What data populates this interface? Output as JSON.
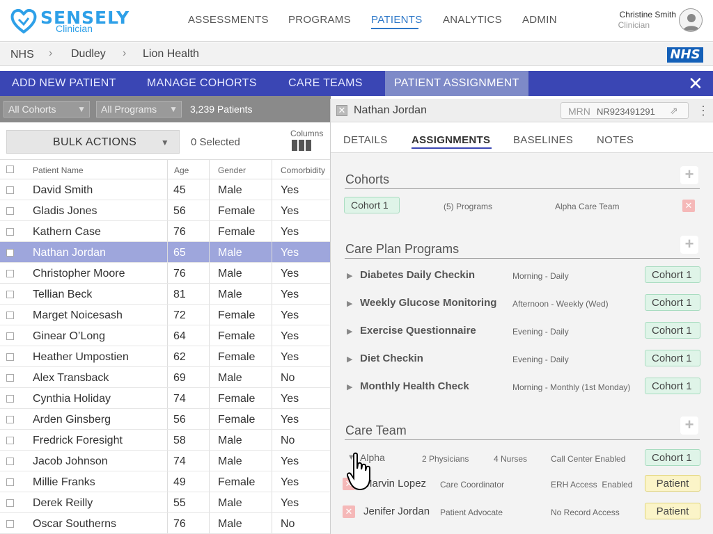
{
  "app": {
    "brand": "SENSELY",
    "subbrand": "Clinician",
    "nav": [
      "ASSESSMENTS",
      "PROGRAMS",
      "PATIENTS",
      "ANALYTICS",
      "ADMIN"
    ],
    "user_name": "Christine Smith",
    "user_role": "Clinician"
  },
  "breadcrumb": [
    "NHS",
    "Dudley",
    "Lion Health"
  ],
  "nhs_badge": "NHS",
  "band": {
    "tabs": [
      "ADD NEW PATIENT",
      "MANAGE COHORTS",
      "CARE TEAMS",
      "PATIENT ASSIGNMENT"
    ],
    "close": "✕"
  },
  "filters": {
    "cohorts": "All Cohorts",
    "programs": "All Programs",
    "count": "3,239 Patients"
  },
  "actions": {
    "bulk": "BULK ACTIONS",
    "selected": "0 Selected",
    "columns": "Columns"
  },
  "table": {
    "headers": [
      "Patient Name",
      "Age",
      "Gender",
      "Comorbidity"
    ],
    "rows": [
      [
        "David Smith",
        "45",
        "Male",
        "Yes"
      ],
      [
        "Gladis Jones",
        "56",
        "Female",
        "Yes"
      ],
      [
        "Kathern Case",
        "76",
        "Female",
        "Yes"
      ],
      [
        "Nathan Jordan",
        "65",
        "Male",
        "Yes"
      ],
      [
        "Christopher Moore",
        "76",
        "Male",
        "Yes"
      ],
      [
        "Tellian Beck",
        "81",
        "Male",
        "Yes"
      ],
      [
        "Marget Noicesash",
        "72",
        "Female",
        "Yes"
      ],
      [
        "Ginear O’Long",
        "64",
        "Female",
        "Yes"
      ],
      [
        "Heather Umpostien",
        "62",
        "Female",
        "Yes"
      ],
      [
        "Alex Transback",
        "69",
        "Male",
        "No"
      ],
      [
        "Cynthia Holiday",
        "74",
        "Female",
        "Yes"
      ],
      [
        "Arden Ginsberg",
        "56",
        "Female",
        "Yes"
      ],
      [
        "Fredrick Foresight",
        "58",
        "Male",
        "No"
      ],
      [
        "Jacob Johnson",
        "74",
        "Male",
        "Yes"
      ],
      [
        "Millie Franks",
        "49",
        "Female",
        "Yes"
      ],
      [
        "Derek Reilly",
        "55",
        "Male",
        "Yes"
      ],
      [
        "Oscar Southerns",
        "76",
        "Male",
        "No"
      ]
    ]
  },
  "panel": {
    "patient_name": "Nathan Jordan",
    "mrn_label": "MRN",
    "mrn_value": "NR923491291",
    "tabs": [
      "DETAILS",
      "ASSIGNMENTS",
      "BASELINES",
      "NOTES"
    ],
    "cohorts": {
      "title": "Cohorts",
      "cohort": "Cohort 1",
      "programs": "(5) Programs",
      "team": "Alpha Care Team"
    },
    "programs": {
      "title": "Care Plan Programs",
      "items": [
        {
          "name": "Diabetes Daily Checkin",
          "schedule": "Morning - Daily",
          "cohort": "Cohort 1"
        },
        {
          "name": "Weekly Glucose Monitoring",
          "schedule": "Afternoon - Weekly (Wed)",
          "cohort": "Cohort 1"
        },
        {
          "name": "Exercise Questionnaire",
          "schedule": "Evening - Daily",
          "cohort": "Cohort 1"
        },
        {
          "name": "Diet Checkin",
          "schedule": "Evening - Daily",
          "cohort": "Cohort 1"
        },
        {
          "name": "Monthly Health Check",
          "schedule": "Morning - Monthly (1st Monday)",
          "cohort": "Cohort 1"
        }
      ]
    },
    "care_team": {
      "title": "Care Team",
      "team_name": "Alpha",
      "physicians": "2 Physicians",
      "nurses": "4 Nurses",
      "call_center": "Call Center Enabled",
      "cohort": "Cohort 1",
      "members": [
        {
          "name": "Marvin Lopez",
          "role": "Care Coordinator",
          "access": "ERH Access  Enabled",
          "tag": "Patient"
        },
        {
          "name": "Jenifer Jordan",
          "role": "Patient Advocate",
          "access": "No Record Access",
          "tag": "Patient"
        }
      ]
    }
  },
  "colors": {
    "brand": "#2ea0e8",
    "band": "#3a46b4",
    "selected_row": "#9ea6dc",
    "nhs": "#1460b8"
  }
}
